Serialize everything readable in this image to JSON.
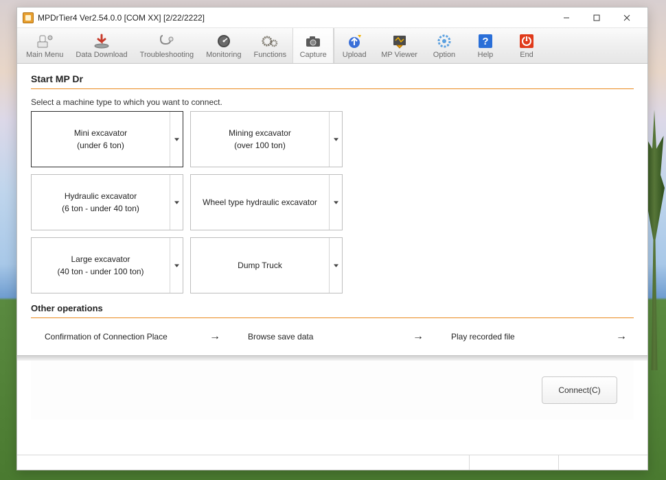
{
  "window": {
    "title": "MPDrTier4 Ver2.54.0.0 [COM XX] [2/22/2222]"
  },
  "toolbar": {
    "items": [
      {
        "key": "main-menu",
        "label": "Main Menu"
      },
      {
        "key": "data-download",
        "label": "Data Download"
      },
      {
        "key": "troubleshoot",
        "label": "Troubleshooting"
      },
      {
        "key": "monitoring",
        "label": "Monitoring"
      },
      {
        "key": "functions",
        "label": "Functions"
      },
      {
        "key": "capture",
        "label": "Capture"
      },
      {
        "key": "upload",
        "label": "Upload"
      },
      {
        "key": "mp-viewer",
        "label": "MP Viewer"
      },
      {
        "key": "option",
        "label": "Option"
      },
      {
        "key": "help",
        "label": "Help"
      },
      {
        "key": "end",
        "label": "End"
      }
    ]
  },
  "main": {
    "heading": "Start MP Dr",
    "instruction": "Select a machine type to which you want to connect.",
    "machines": [
      {
        "line1": "Mini excavator",
        "line2": "(under 6 ton)",
        "selected": true
      },
      {
        "line1": "Mining excavator",
        "line2": "(over 100 ton)",
        "selected": false
      },
      {
        "line1": "Hydraulic excavator",
        "line2": "(6 ton - under 40 ton)",
        "selected": false
      },
      {
        "line1": "Wheel type hydraulic excavator",
        "line2": "",
        "selected": false
      },
      {
        "line1": "Large excavator",
        "line2": "(40 ton - under 100 ton)",
        "selected": false
      },
      {
        "line1": "Dump Truck",
        "line2": "",
        "selected": false
      }
    ],
    "other_heading": "Other operations",
    "other_ops": [
      {
        "label": "Confirmation of Connection Place"
      },
      {
        "label": "Browse save data"
      },
      {
        "label": "Play recorded file"
      }
    ],
    "connect_label": "Connect(C)"
  }
}
